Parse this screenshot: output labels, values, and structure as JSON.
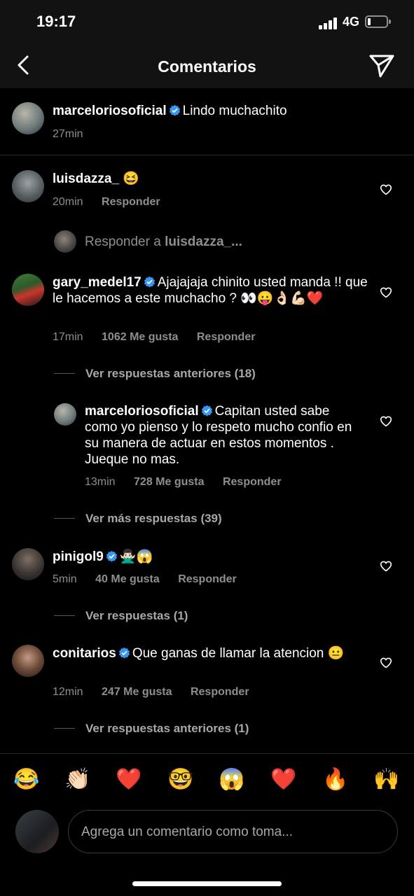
{
  "status": {
    "time": "19:17",
    "network": "4G"
  },
  "header": {
    "title": "Comentarios"
  },
  "caption": {
    "user": "marceloriosoficial",
    "text": "Lindo muchachito",
    "time": "27min"
  },
  "comments": [
    {
      "user": "luisdazza_",
      "text": "😆",
      "time": "20min",
      "likes": "",
      "reply": "Responder"
    },
    {
      "user": "gary_medel17",
      "text": "Ajajajaja chinito usted manda !! que le hacemos a este muchacho ? 👀😛👌🏻💪🏻❤️",
      "time": "17min",
      "likes": "1062 Me gusta",
      "reply": "Responder",
      "view_replies": "Ver respuestas anteriores (18)"
    },
    {
      "user": "pinigol9",
      "text": "🙅🏻‍♂️😱",
      "time": "5min",
      "likes": "40 Me gusta",
      "reply": "Responder",
      "view_replies": "Ver respuestas (1)"
    },
    {
      "user": "conitarios",
      "text": "Que ganas de llamar la atencion 😐",
      "time": "12min",
      "likes": "247 Me gusta",
      "reply": "Responder",
      "view_replies": "Ver respuestas anteriores (1)"
    }
  ],
  "reply_prompt": {
    "prefix": "Responder a ",
    "user": "luisdazza_..."
  },
  "nested_reply": {
    "user": "marceloriosoficial",
    "text": "Capitan usted sabe como yo pienso y lo respeto mucho confio en su manera de actuar en estos momentos . Jueque no mas.",
    "time": "13min",
    "likes": "728 Me gusta",
    "reply": "Responder",
    "more": "Ver más respuestas (39)"
  },
  "emojis": [
    "😂",
    "👏🏻",
    "❤️",
    "🤓",
    "😱",
    "❤️",
    "🔥",
    "🙌"
  ],
  "input": {
    "placeholder": "Agrega un comentario como toma..."
  },
  "colors": {
    "verified": "#3897f0",
    "background": "#000000",
    "muted": "#8e8e8e"
  }
}
